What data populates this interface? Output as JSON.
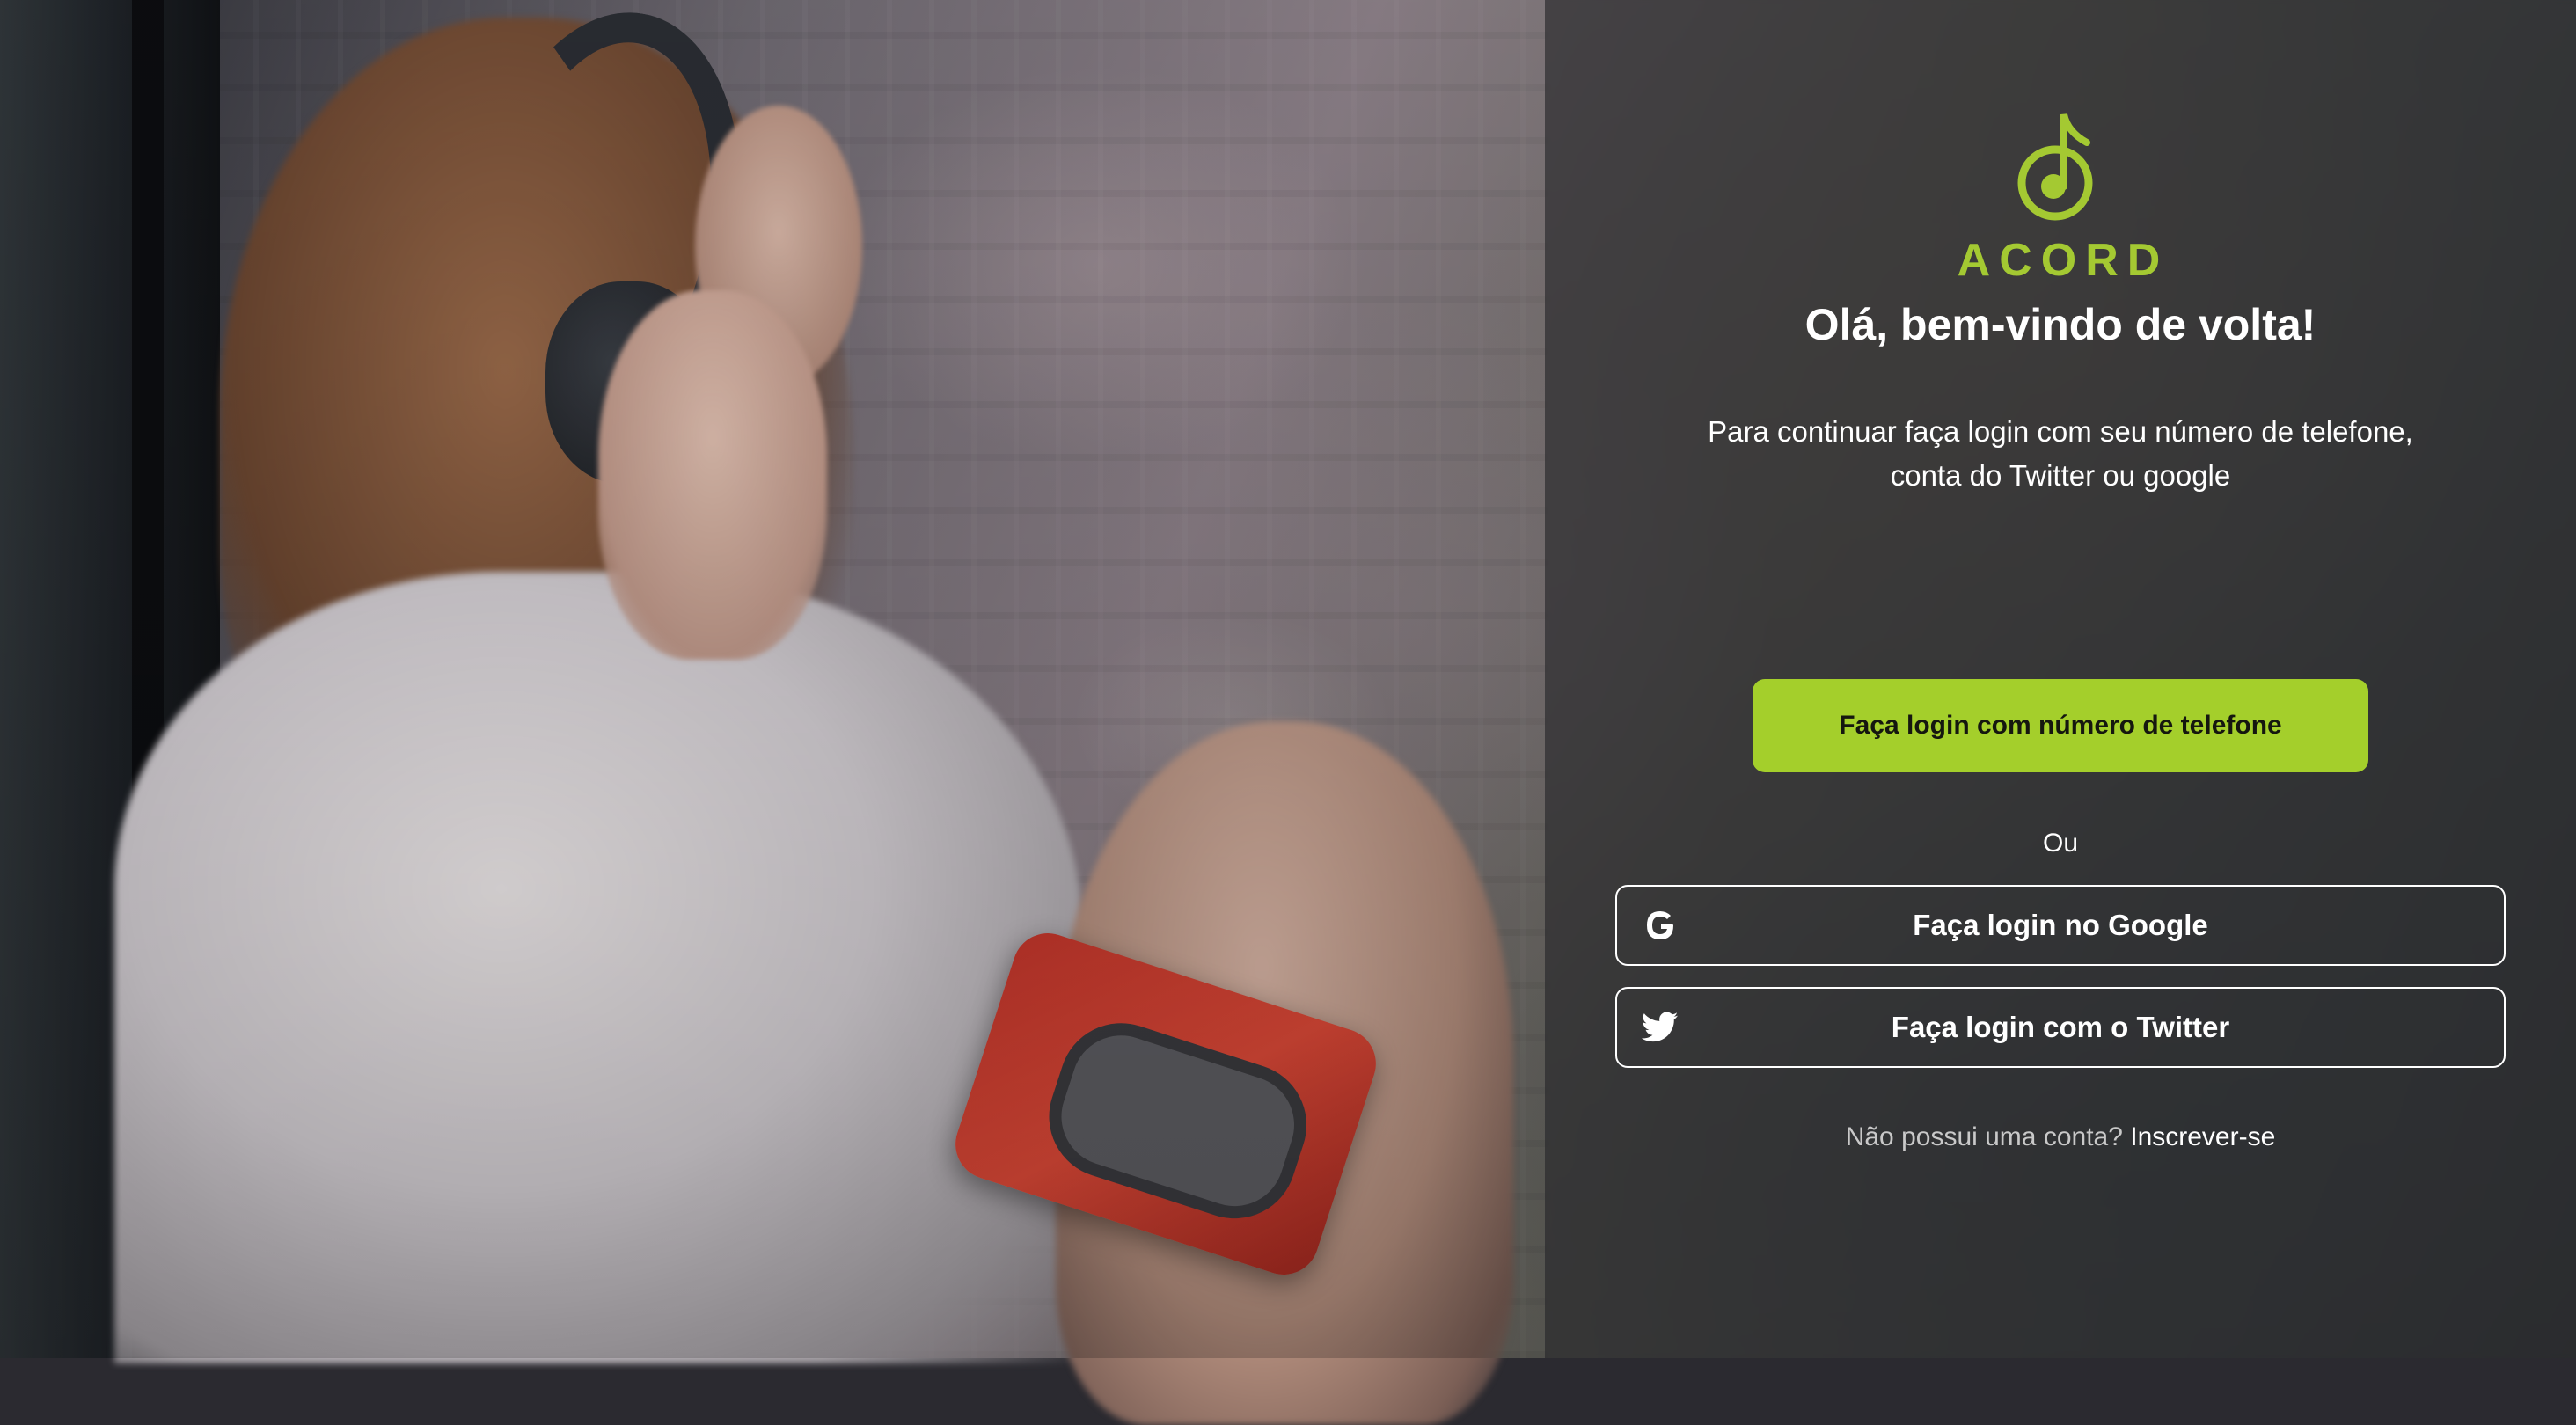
{
  "colors": {
    "accent": "#a4cf2b",
    "logo": "#a4c932",
    "panel": "rgba(40,40,42,0.66)",
    "text": "#ffffff",
    "muted_text": "#c9c9c9"
  },
  "brand": {
    "logo_icon": "music-note-icon",
    "name": "ACORD"
  },
  "welcome": {
    "headline": "Olá, bem-vindo de volta!",
    "subtitle_line1": "Para continuar faça login com seu número de telefone,",
    "subtitle_line2": "conta do Twitter ou google"
  },
  "actions": {
    "phone_login_label": "Faça login com número de telefone",
    "separator": "Ou",
    "google_login_label": "Faça login no Google",
    "google_icon": "google-icon",
    "twitter_login_label": "Faça login com o Twitter",
    "twitter_icon": "twitter-icon"
  },
  "signup": {
    "prompt": "Não possui uma conta?",
    "link_label": "Inscrever-se"
  }
}
